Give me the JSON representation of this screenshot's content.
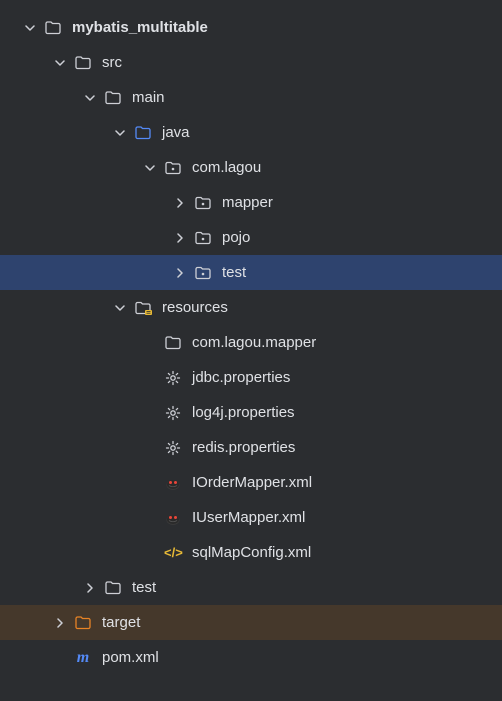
{
  "tree": [
    {
      "id": "root",
      "depth": 0,
      "arrow": "down",
      "icon": "folder",
      "label": "mybatis_multitable",
      "bold": true,
      "selected": false,
      "highlighted": false,
      "iconColor": "#ced0d6"
    },
    {
      "id": "src",
      "depth": 1,
      "arrow": "down",
      "icon": "folder",
      "label": "src",
      "bold": false,
      "selected": false,
      "highlighted": false,
      "iconColor": "#ced0d6"
    },
    {
      "id": "main",
      "depth": 2,
      "arrow": "down",
      "icon": "folder",
      "label": "main",
      "bold": false,
      "selected": false,
      "highlighted": false,
      "iconColor": "#ced0d6"
    },
    {
      "id": "java",
      "depth": 3,
      "arrow": "down",
      "icon": "folder",
      "label": "java",
      "bold": false,
      "selected": false,
      "highlighted": false,
      "iconColor": "#548af7"
    },
    {
      "id": "com-lagou",
      "depth": 4,
      "arrow": "down",
      "icon": "package",
      "label": "com.lagou",
      "bold": false,
      "selected": false,
      "highlighted": false,
      "iconColor": "#ced0d6"
    },
    {
      "id": "mapper",
      "depth": 5,
      "arrow": "right",
      "icon": "package",
      "label": "mapper",
      "bold": false,
      "selected": false,
      "highlighted": false,
      "iconColor": "#ced0d6"
    },
    {
      "id": "pojo",
      "depth": 5,
      "arrow": "right",
      "icon": "package",
      "label": "pojo",
      "bold": false,
      "selected": false,
      "highlighted": false,
      "iconColor": "#ced0d6"
    },
    {
      "id": "test-pkg",
      "depth": 5,
      "arrow": "right",
      "icon": "package",
      "label": "test",
      "bold": false,
      "selected": true,
      "highlighted": false,
      "iconColor": "#ced0d6"
    },
    {
      "id": "resources",
      "depth": 3,
      "arrow": "down",
      "icon": "resources",
      "label": "resources",
      "bold": false,
      "selected": false,
      "highlighted": false,
      "iconColor": "#ced0d6"
    },
    {
      "id": "com-lagou-mapper",
      "depth": 4,
      "arrow": "blank",
      "icon": "folder",
      "label": "com.lagou.mapper",
      "bold": false,
      "selected": false,
      "highlighted": false,
      "iconColor": "#ced0d6"
    },
    {
      "id": "jdbc-props",
      "depth": 4,
      "arrow": "blank",
      "icon": "gear",
      "label": "jdbc.properties",
      "bold": false,
      "selected": false,
      "highlighted": false,
      "iconColor": "#ced0d6"
    },
    {
      "id": "log4j-props",
      "depth": 4,
      "arrow": "blank",
      "icon": "gear",
      "label": "log4j.properties",
      "bold": false,
      "selected": false,
      "highlighted": false,
      "iconColor": "#ced0d6"
    },
    {
      "id": "redis-props",
      "depth": 4,
      "arrow": "blank",
      "icon": "gear",
      "label": "redis.properties",
      "bold": false,
      "selected": false,
      "highlighted": false,
      "iconColor": "#ced0d6"
    },
    {
      "id": "iorder-mapper",
      "depth": 4,
      "arrow": "blank",
      "icon": "mybatis",
      "label": "IOrderMapper.xml",
      "bold": false,
      "selected": false,
      "highlighted": false,
      "iconColor": "#ced0d6"
    },
    {
      "id": "iuser-mapper",
      "depth": 4,
      "arrow": "blank",
      "icon": "mybatis",
      "label": "IUserMapper.xml",
      "bold": false,
      "selected": false,
      "highlighted": false,
      "iconColor": "#ced0d6"
    },
    {
      "id": "sqlmap-config",
      "depth": 4,
      "arrow": "blank",
      "icon": "xml",
      "label": "sqlMapConfig.xml",
      "bold": false,
      "selected": false,
      "highlighted": false,
      "iconColor": "#ced0d6"
    },
    {
      "id": "test-folder",
      "depth": 2,
      "arrow": "right",
      "icon": "folder",
      "label": "test",
      "bold": false,
      "selected": false,
      "highlighted": false,
      "iconColor": "#ced0d6"
    },
    {
      "id": "target",
      "depth": 1,
      "arrow": "right",
      "icon": "folder",
      "label": "target",
      "bold": false,
      "selected": false,
      "highlighted": true,
      "iconColor": "#e88325"
    },
    {
      "id": "pom-xml",
      "depth": 1,
      "arrow": "blank",
      "icon": "m",
      "label": "pom.xml",
      "bold": false,
      "selected": false,
      "highlighted": false,
      "iconColor": "#ced0d6"
    }
  ]
}
